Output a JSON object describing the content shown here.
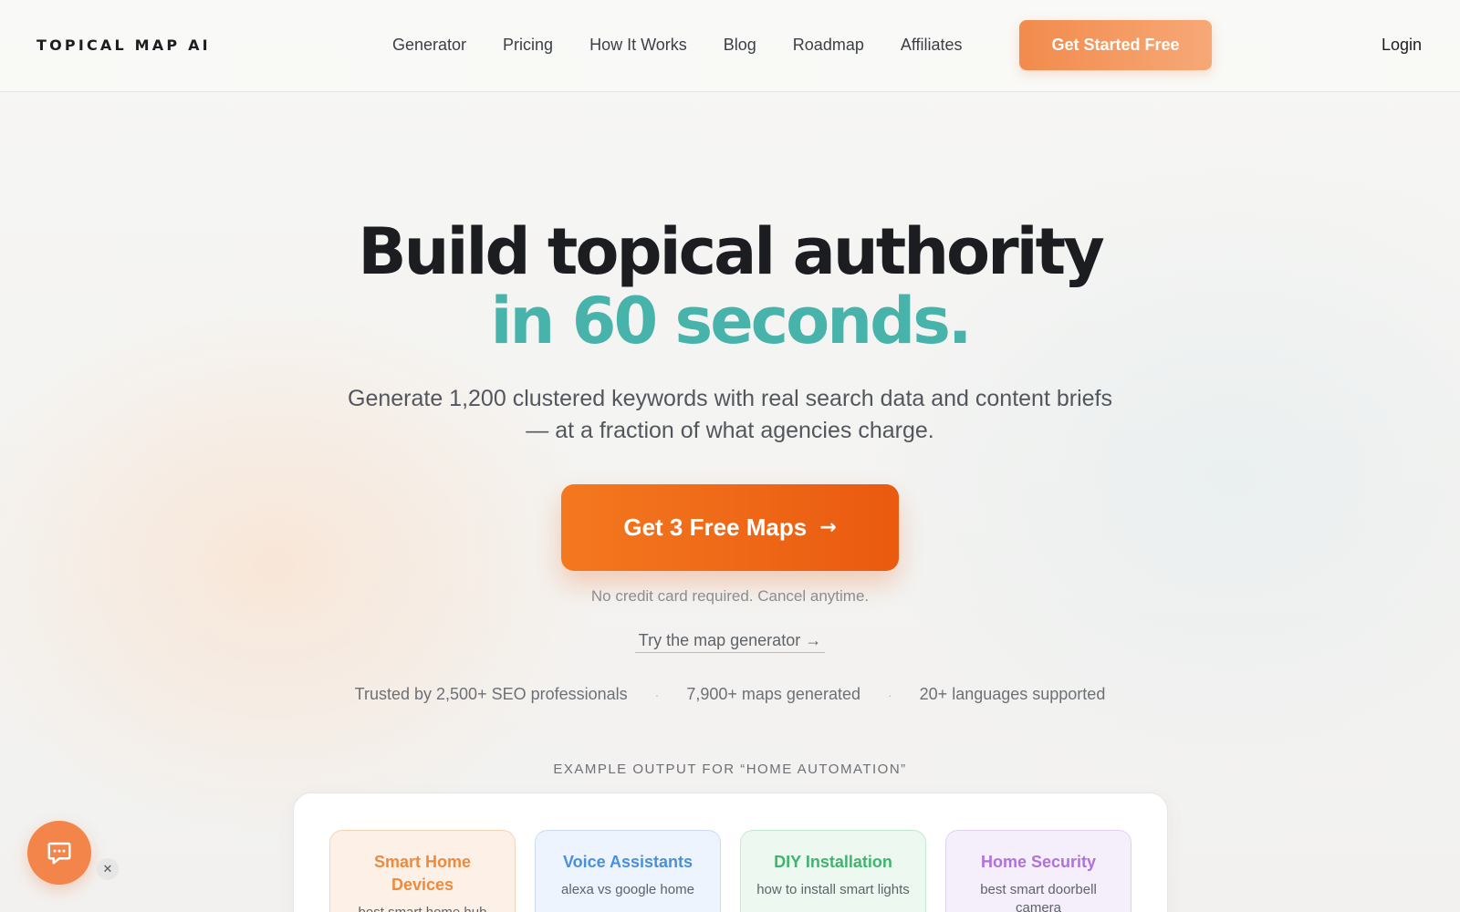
{
  "nav": {
    "logo": "TOPICAL MAP AI",
    "links": [
      "Generator",
      "Pricing",
      "How It Works",
      "Blog",
      "Roadmap",
      "Affiliates"
    ],
    "cta_label": "Get Started Free",
    "login_label": "Login"
  },
  "hero": {
    "headline_line1": "Build topical authority",
    "headline_line2": "in 60 seconds.",
    "subhead": "Generate 1,200 clustered keywords with real search data and content briefs — at a fraction of what agencies charge.",
    "cta_label": "Get 3 Free Maps",
    "cta_arrow": "→",
    "note": "No credit card required. Cancel anytime.",
    "try_link": "Try the map generator →",
    "stats": [
      "Trusted by 2,500+ SEO professionals",
      "7,900+ maps generated",
      "20+ languages supported"
    ],
    "stat_separator": "·"
  },
  "example": {
    "label": "EXAMPLE OUTPUT FOR “HOME AUTOMATION”",
    "clusters": [
      {
        "title": "Smart Home Devices",
        "keyword": "best smart home hub",
        "color": "#ee8a3e"
      },
      {
        "title": "Voice Assistants",
        "keyword": "alexa vs google home",
        "color": "#4a8fdc"
      },
      {
        "title": "DIY Installation",
        "keyword": "how to install smart lights",
        "color": "#3fb56c"
      },
      {
        "title": "Home Security",
        "keyword": "best smart doorbell camera",
        "color": "#b071d9"
      }
    ]
  },
  "chat": {
    "icon": "chat-bubble-icon",
    "close_glyph": "✕"
  },
  "colors": {
    "accent_teal": "#47b3ab",
    "cta_orange": "#f4781f",
    "nav_cta": "#f28b4c"
  }
}
